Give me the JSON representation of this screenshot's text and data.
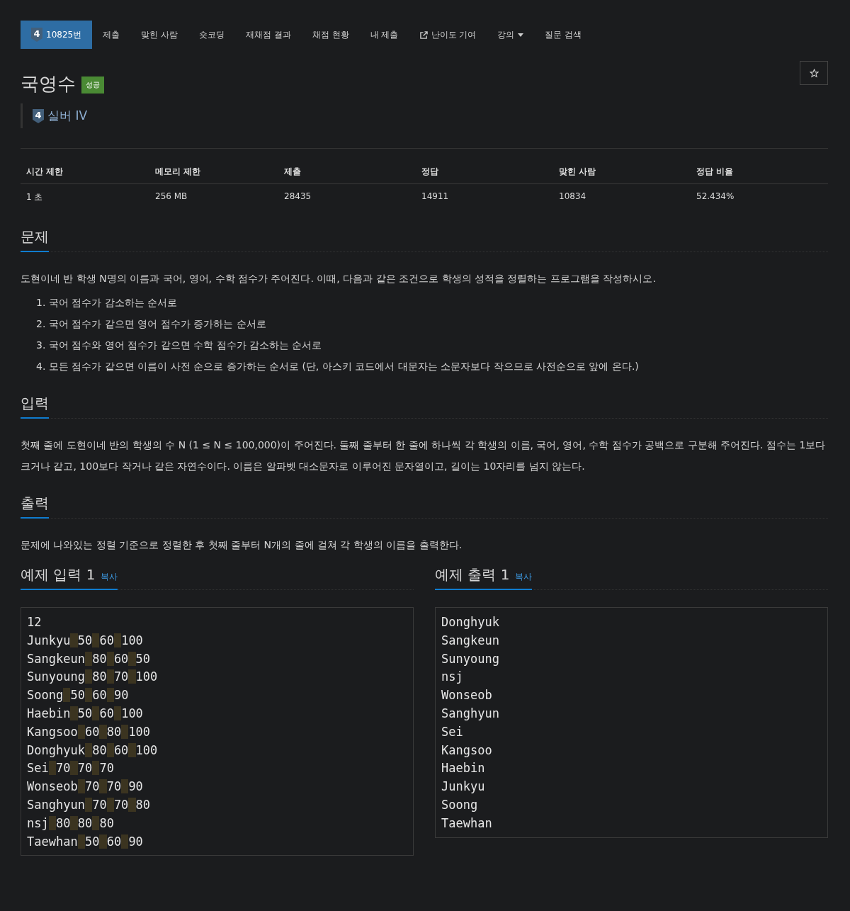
{
  "nav": [
    {
      "label": "10825번",
      "selected": true,
      "kind": "problem",
      "tier_mark": "4"
    },
    {
      "label": "제출",
      "selected": false,
      "kind": "plain"
    },
    {
      "label": "맞힌 사람",
      "selected": false,
      "kind": "plain"
    },
    {
      "label": "숏코딩",
      "selected": false,
      "kind": "plain"
    },
    {
      "label": "재채점 결과",
      "selected": false,
      "kind": "plain"
    },
    {
      "label": "채점 현황",
      "selected": false,
      "kind": "plain"
    },
    {
      "label": "내 제출",
      "selected": false,
      "kind": "plain"
    },
    {
      "label": "난이도 기여",
      "selected": false,
      "kind": "external"
    },
    {
      "label": "강의",
      "selected": false,
      "kind": "dropdown"
    },
    {
      "label": "질문 검색",
      "selected": false,
      "kind": "plain"
    }
  ],
  "problem": {
    "title": "국영수",
    "result_badge": "성공",
    "tier_mark": "4",
    "tier": "실버 IV"
  },
  "limits": {
    "columns": [
      "시간 제한",
      "메모리 제한",
      "제출",
      "정답",
      "맞힌 사람",
      "정답 비율"
    ],
    "row": [
      "1 초",
      "256 MB",
      "28435",
      "14911",
      "10834",
      "52.434%"
    ]
  },
  "sections": [
    {
      "heading": "문제",
      "paragraph": "도현이네 반 학생 N명의 이름과 국어, 영어, 수학 점수가 주어진다. 이때, 다음과 같은 조건으로 학생의 성적을 정렬하는 프로그램을 작성하시오.",
      "list": [
        "1. 국어 점수가 감소하는 순서로",
        "2. 국어 점수가 같으면 영어 점수가 증가하는 순서로",
        "3. 국어 점수와 영어 점수가 같으면 수학 점수가 감소하는 순서로",
        "4. 모든 점수가 같으면 이름이 사전 순으로 증가하는 순서로 (단, 아스키 코드에서 대문자는 소문자보다 작으므로 사전순으로 앞에 온다.)"
      ]
    },
    {
      "heading": "입력",
      "paragraph": "첫째 줄에 도현이네 반의 학생의 수 N (1 ≤ N ≤ 100,000)이 주어진다. 둘째 줄부터 한 줄에 하나씩 각 학생의 이름, 국어, 영어, 수학 점수가 공백으로 구분해 주어진다. 점수는 1보다 크거나 같고, 100보다 작거나 같은 자연수이다. 이름은 알파벳 대소문자로 이루어진 문자열이고, 길이는 10자리를 넘지 않는다."
    },
    {
      "heading": "출력",
      "paragraph": "문제에 나와있는 정렬 기준으로 정렬한 후 첫째 줄부터 N개의 줄에 걸쳐 각 학생의 이름을 출력한다."
    }
  ],
  "samples": [
    {
      "heading": "예제 입력 1",
      "copy": "복사",
      "lines": [
        "12",
        "Junkyu 50 60 100",
        "Sangkeun 80 60 50",
        "Sunyoung 80 70 100",
        "Soong 50 60 90",
        "Haebin 50 60 100",
        "Kangsoo 60 80 100",
        "Donghyuk 80 60 100",
        "Sei 70 70 70",
        "Wonseob 70 70 90",
        "Sanghyun 70 70 80",
        "nsj 80 80 80",
        "Taewhan 50 60 90"
      ]
    },
    {
      "heading": "예제 출력 1",
      "copy": "복사",
      "lines": [
        "Donghyuk",
        "Sangkeun",
        "Sunyoung",
        "nsj",
        "Wonseob",
        "Sanghyun",
        "Sei",
        "Kangsoo",
        "Haebin",
        "Junkyu",
        "Soong",
        "Taewhan"
      ]
    }
  ]
}
